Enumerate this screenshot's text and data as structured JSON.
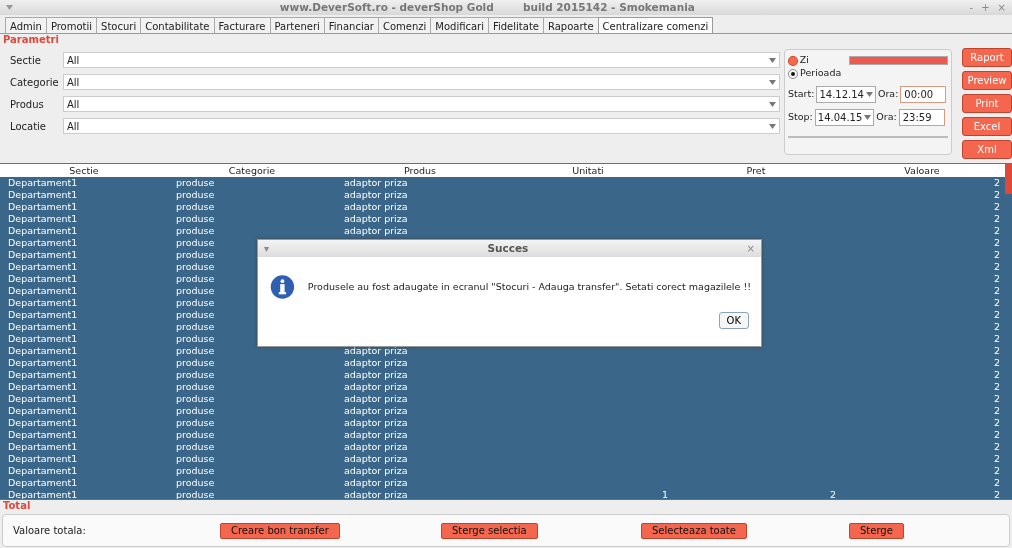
{
  "window": {
    "title": "www.DeverSoft.ro - deverShop Gold        build 2015142 - Smokemania",
    "controls": [
      "-",
      "+",
      "×"
    ]
  },
  "tabs": [
    {
      "label": "Admin",
      "selected": false
    },
    {
      "label": "Promotii",
      "selected": false
    },
    {
      "label": "Stocuri",
      "selected": false
    },
    {
      "label": "Contabilitate",
      "selected": false
    },
    {
      "label": "Facturare",
      "selected": false
    },
    {
      "label": "Parteneri",
      "selected": false
    },
    {
      "label": "Financiar",
      "selected": false
    },
    {
      "label": "Comenzi",
      "selected": false
    },
    {
      "label": "Modificari",
      "selected": false
    },
    {
      "label": "Fidelitate",
      "selected": false
    },
    {
      "label": "Rapoarte",
      "selected": false
    },
    {
      "label": "Centralizare comenzi",
      "selected": true
    }
  ],
  "parametri": {
    "title": "Parametri",
    "filters": [
      {
        "label": "Sectie",
        "value": "All"
      },
      {
        "label": "Categorie",
        "value": "All"
      },
      {
        "label": "Produs",
        "value": "All"
      },
      {
        "label": "Locatie",
        "value": "All"
      }
    ],
    "period": [
      {
        "label": "Zi",
        "selected": false
      },
      {
        "label": "Perioada",
        "selected": true
      }
    ],
    "start": {
      "label": "Start:",
      "date": "14.12.14",
      "ora_label": "Ora:",
      "ora": "00:00"
    },
    "stop": {
      "label": "Stop:",
      "date": "14.04.15",
      "ora_label": "Ora:",
      "ora": "23:59"
    }
  },
  "side_buttons": [
    "Raport",
    "Preview",
    "Print",
    "Excel",
    "Xml"
  ],
  "table": {
    "columns": [
      "Sectie",
      "Categorie",
      "Produs",
      "Unitati",
      "Pret",
      "Valoare"
    ],
    "rows": [
      {
        "sectie": "Departament1",
        "categorie": "produse",
        "produs": "adaptor priza",
        "valoare": "2"
      },
      {
        "sectie": "Departament1",
        "categorie": "produse",
        "produs": "adaptor priza",
        "valoare": "2"
      },
      {
        "sectie": "Departament1",
        "categorie": "produse",
        "produs": "adaptor priza",
        "valoare": "2"
      },
      {
        "sectie": "Departament1",
        "categorie": "produse",
        "produs": "adaptor priza",
        "valoare": "2"
      },
      {
        "sectie": "Departament1",
        "categorie": "produse",
        "produs": "adaptor priza",
        "valoare": "2"
      },
      {
        "sectie": "Departament1",
        "categorie": "produse",
        "valoare": "2"
      },
      {
        "sectie": "Departament1",
        "categorie": "produse",
        "valoare": "2"
      },
      {
        "sectie": "Departament1",
        "categorie": "produse",
        "valoare": "2"
      },
      {
        "sectie": "Departament1",
        "categorie": "produse",
        "valoare": "2"
      },
      {
        "sectie": "Departament1",
        "categorie": "produse",
        "valoare": "2"
      },
      {
        "sectie": "Departament1",
        "categorie": "produse",
        "valoare": "2"
      },
      {
        "sectie": "Departament1",
        "categorie": "produse",
        "valoare": "2"
      },
      {
        "sectie": "Departament1",
        "categorie": "produse",
        "valoare": "2"
      },
      {
        "sectie": "Departament1",
        "categorie": "produse",
        "valoare": "2"
      },
      {
        "sectie": "Departament1",
        "categorie": "produse",
        "produs": "adaptor priza",
        "valoare": "2"
      },
      {
        "sectie": "Departament1",
        "categorie": "produse",
        "produs": "adaptor priza",
        "valoare": "2"
      },
      {
        "sectie": "Departament1",
        "categorie": "produse",
        "produs": "adaptor priza",
        "valoare": "2"
      },
      {
        "sectie": "Departament1",
        "categorie": "produse",
        "produs": "adaptor priza",
        "valoare": "2"
      },
      {
        "sectie": "Departament1",
        "categorie": "produse",
        "produs": "adaptor priza",
        "valoare": "2"
      },
      {
        "sectie": "Departament1",
        "categorie": "produse",
        "produs": "adaptor priza",
        "valoare": "2"
      },
      {
        "sectie": "Departament1",
        "categorie": "produse",
        "produs": "adaptor priza",
        "valoare": "2"
      },
      {
        "sectie": "Departament1",
        "categorie": "produse",
        "produs": "adaptor priza",
        "valoare": "2"
      },
      {
        "sectie": "Departament1",
        "categorie": "produse",
        "produs": "adaptor priza",
        "valoare": "2"
      },
      {
        "sectie": "Departament1",
        "categorie": "produse",
        "produs": "adaptor priza",
        "valoare": "2"
      },
      {
        "sectie": "Departament1",
        "categorie": "produse",
        "produs": "adaptor priza",
        "valoare": "2"
      },
      {
        "sectie": "Departament1",
        "categorie": "produse",
        "produs": "adaptor priza",
        "valoare": "2"
      },
      {
        "sectie": "Departament1",
        "categorie": "produse",
        "produs": "adaptor priza",
        "unitati": "1",
        "pret": "2",
        "valoare": "2"
      }
    ]
  },
  "total": {
    "title": "Total",
    "label": "Valoare totala:",
    "buttons": [
      "Creare bon transfer",
      "Sterge selectia",
      "Selecteaza toate",
      "Sterge"
    ]
  },
  "dialog": {
    "title": "Succes",
    "menu": "▾",
    "close": "×",
    "message": "Produsele au fost adaugate in ecranul \"Stocuri - Adauga transfer\". Setati corect magazilele !!",
    "button": "OK"
  }
}
